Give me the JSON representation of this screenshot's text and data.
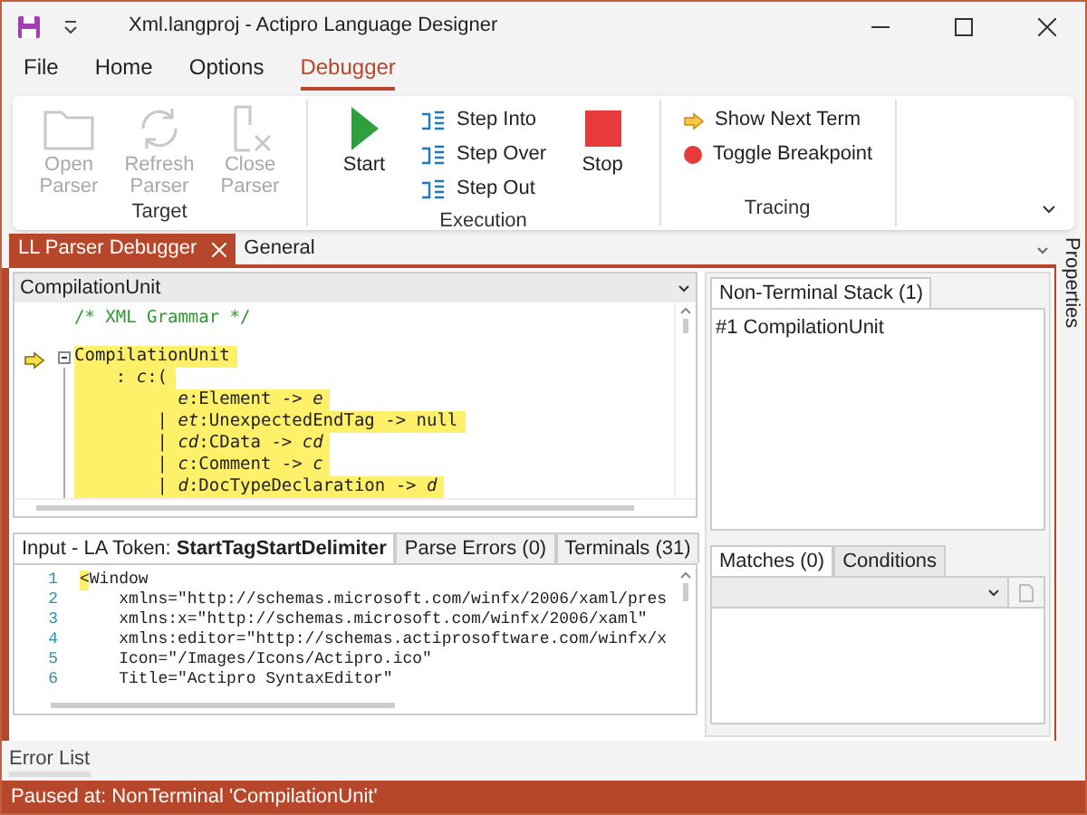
{
  "window": {
    "title": "Xml.langproj - Actipro Language Designer"
  },
  "menu": [
    {
      "label": "File",
      "selected": false
    },
    {
      "label": "Home",
      "selected": false
    },
    {
      "label": "Options",
      "selected": false
    },
    {
      "label": "Debugger",
      "selected": true
    }
  ],
  "ribbon": [
    {
      "label": "Target",
      "items": [
        {
          "label": "Open Parser",
          "kind": "open",
          "disabled": true
        },
        {
          "label": "Refresh Parser",
          "kind": "refresh",
          "disabled": true
        },
        {
          "label": "Close Parser",
          "kind": "close",
          "disabled": true
        }
      ]
    },
    {
      "label": "Execution",
      "items": [
        {
          "label": "Start",
          "kind": "start",
          "disabled": false
        },
        {
          "label": "Step Into",
          "kind": "stepinto",
          "disabled": false
        },
        {
          "label": "Step Over",
          "kind": "stepover",
          "disabled": false
        },
        {
          "label": "Step Out",
          "kind": "stepout",
          "disabled": false
        },
        {
          "label": "Stop",
          "kind": "stop",
          "disabled": false
        }
      ]
    },
    {
      "label": "Tracing",
      "items": [
        {
          "label": "Show Next Term",
          "kind": "next",
          "disabled": false
        },
        {
          "label": "Toggle Breakpoint",
          "kind": "breakpoint",
          "disabled": false
        }
      ]
    }
  ],
  "doc_tabs": [
    {
      "label": "LL Parser Debugger",
      "selected": true,
      "closable": true
    },
    {
      "label": "General",
      "selected": false,
      "closable": false
    }
  ],
  "grammar_editor": {
    "selector": "CompilationUnit",
    "comment": "/* XML Grammar */",
    "lines": [
      {
        "kind": "code",
        "text": "CompilationUnit",
        "highlighted": true,
        "current": true,
        "fold": true
      },
      {
        "kind": "code",
        "text": "    : *c*:(",
        "highlighted": true,
        "current": false,
        "fold": false
      },
      {
        "kind": "code",
        "text": "          *e*:Element -> *e*",
        "highlighted": true,
        "current": false,
        "fold": false
      },
      {
        "kind": "code",
        "text": "        | *et*:UnexpectedEndTag -> null",
        "highlighted": true,
        "current": false,
        "fold": false
      },
      {
        "kind": "code",
        "text": "        | *cd*:CData -> *cd*",
        "highlighted": true,
        "current": false,
        "fold": false
      },
      {
        "kind": "code",
        "text": "        | *c*:Comment -> *c*",
        "highlighted": true,
        "current": false,
        "fold": false
      },
      {
        "kind": "code",
        "text": "        | *d*:DocTypeDeclaration -> *d*",
        "highlighted": true,
        "current": false,
        "fold": false
      }
    ]
  },
  "input_tabs": [
    {
      "label": "Input - LA Token: **StartTagStartDelimiter**",
      "selected": true
    },
    {
      "label": "Parse Errors (0)",
      "selected": false
    },
    {
      "label": "Terminals (31)",
      "selected": false
    }
  ],
  "input_editor": {
    "lines": [
      {
        "number": "1",
        "token": "<",
        "text": "Window"
      },
      {
        "number": "2",
        "text": "    xmlns=\"http://schemas.microsoft.com/winfx/2006/xaml/pres"
      },
      {
        "number": "3",
        "text": "    xmlns:x=\"http://schemas.microsoft.com/winfx/2006/xaml\""
      },
      {
        "number": "4",
        "text": "    xmlns:editor=\"http://schemas.actiprosoftware.com/winfx/x"
      },
      {
        "number": "5",
        "text": "    Icon=\"/Images/Icons/Actipro.ico\""
      },
      {
        "number": "6",
        "text": "    Title=\"Actipro SyntaxEditor\""
      }
    ]
  },
  "stack_tabs": [
    {
      "label": "Non-Terminal Stack (1)",
      "selected": true
    }
  ],
  "stack_items": [
    "#1 CompilationUnit"
  ],
  "match_tabs": [
    {
      "label": "Matches (0)",
      "selected": true
    },
    {
      "label": "Conditions",
      "selected": false
    }
  ],
  "side_tab": "Properties",
  "bottom_tab": "Error List",
  "status": "Paused at: NonTerminal 'CompilationUnit'"
}
